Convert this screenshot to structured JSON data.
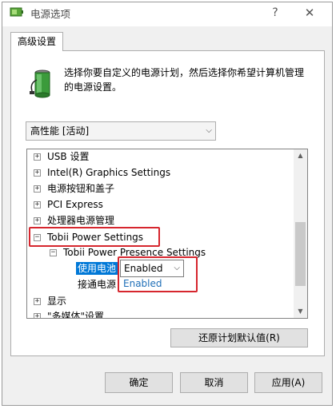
{
  "window": {
    "title": "电源选项",
    "help_glyph": "?",
    "close_glyph": "✕"
  },
  "tabs": [
    {
      "label": "高级设置"
    }
  ],
  "description": "选择你要自定义的电源计划，然后选择你希望计算机管理的电源设置。",
  "plan_select": {
    "value": "高性能 [活动]"
  },
  "tree": {
    "items": [
      {
        "label": "USB 设置",
        "expander": "+"
      },
      {
        "label": "Intel(R) Graphics Settings",
        "expander": "+"
      },
      {
        "label": "电源按钮和盖子",
        "expander": "+"
      },
      {
        "label": "PCI Express",
        "expander": "+"
      },
      {
        "label": "处理器电源管理",
        "expander": "+"
      },
      {
        "label": "Tobii Power Settings",
        "expander": "−"
      },
      {
        "label": "Tobii Power Presence Settings",
        "expander": "−"
      },
      {
        "label": "使用电池",
        "selected": true
      },
      {
        "label": "接通电源"
      },
      {
        "label": "显示",
        "expander": "+"
      },
      {
        "label": "\"多媒体\"设置",
        "expander": "+"
      }
    ],
    "setting_combo": {
      "value": "Enabled",
      "options": [
        "Enabled"
      ]
    }
  },
  "restore_button": "还原计划默认值(R)",
  "buttons": {
    "ok": "确定",
    "cancel": "取消",
    "apply": "应用(A)"
  },
  "colors": {
    "highlight": "#d6262e",
    "selection": "#0078d7",
    "link_blue": "#1e6eb7"
  }
}
